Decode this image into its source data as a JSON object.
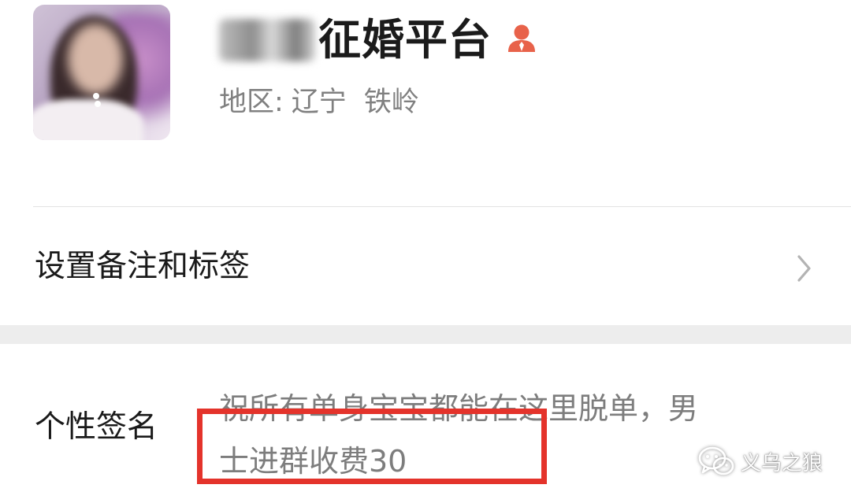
{
  "profile": {
    "name_visible": "征婚平台",
    "region_label": "地区:",
    "region_province": "辽宁",
    "region_city": "铁岭",
    "contact_icon": "person-icon",
    "contact_icon_color": "#e8624a"
  },
  "remark_row": {
    "label": "设置备注和标签",
    "chevron_icon": "chevron-right-icon"
  },
  "signature_row": {
    "label": "个性签名",
    "text_line1": "祝所有单身宝宝都能在这里脱单，男",
    "text_line2": "士进群收费30",
    "highlight_color": "#e4332b"
  },
  "watermark": {
    "icon": "wechat-icon",
    "text": "义乌之狼"
  }
}
